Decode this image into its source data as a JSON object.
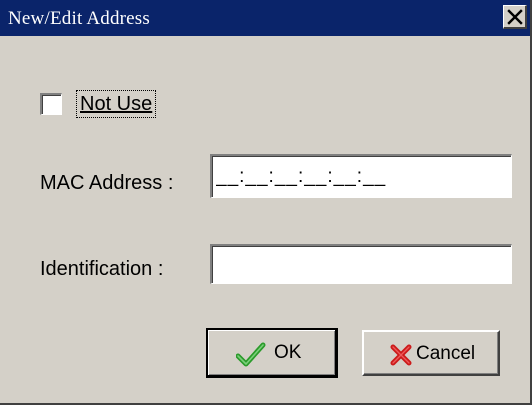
{
  "window": {
    "title": "New/Edit Address",
    "close_glyph": "✕"
  },
  "not_use": {
    "label": "Not Use",
    "checked": false
  },
  "mac_address": {
    "label": "MAC Address :",
    "value": "__:__:__:__:__:__"
  },
  "identification": {
    "label": "Identification :",
    "value": ""
  },
  "buttons": {
    "ok_label": "OK",
    "cancel_label": "Cancel",
    "ok_icon": "checkmark-icon",
    "cancel_icon": "x-icon"
  },
  "colors": {
    "titlebar": "#0a246a",
    "face": "#d4d0c8",
    "ok_icon": "#2a9a2a",
    "cancel_icon": "#cc1a1a"
  }
}
